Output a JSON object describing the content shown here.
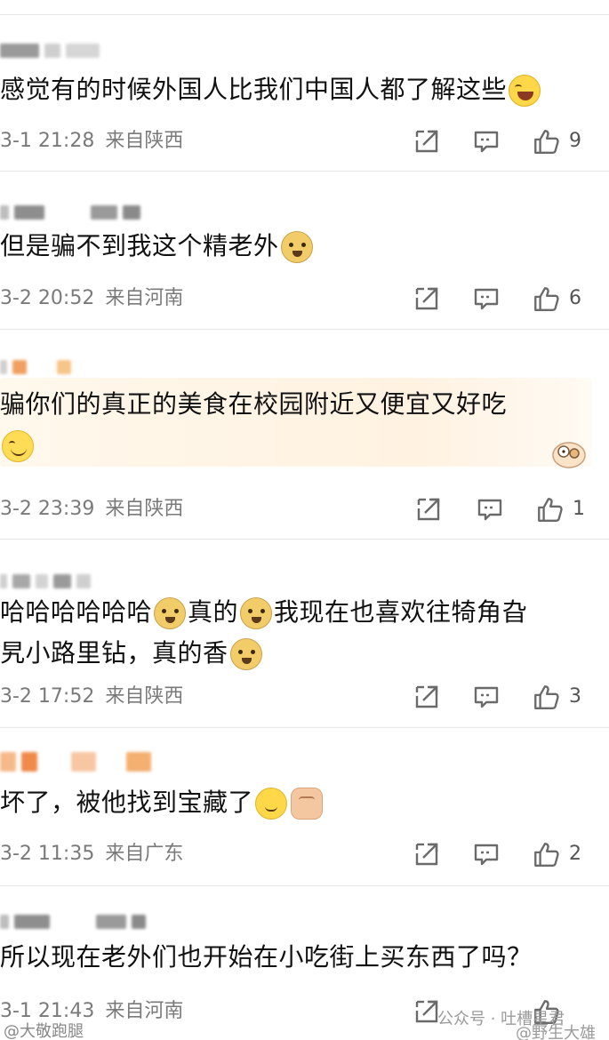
{
  "comments": [
    {
      "text": "感觉有的时候外国人比我们中国人都了解这些",
      "time": "3-1 21:28",
      "location": "来自陕西",
      "likes": "9",
      "emoji": "laugh"
    },
    {
      "text": "但是骗不到我这个精老外",
      "time": "3-2 20:52",
      "location": "来自河南",
      "likes": "6",
      "emoji": "doge"
    },
    {
      "text": "骗你们的真正的美食在校园附近又便宜又好吃",
      "time": "3-2 23:39",
      "location": "来自陕西",
      "likes": "1",
      "emoji": "smile"
    },
    {
      "text_part1": "哈哈哈哈哈哈",
      "text_part2": "真的",
      "text_part3": "我现在也喜欢往犄角旮",
      "text_line2": "旯小路里钻，真的香",
      "time": "3-2 17:52",
      "location": "来自陕西",
      "likes": "3"
    },
    {
      "text": "坏了，被他找到宝藏了",
      "time": "3-2 11:35",
      "location": "来自广东",
      "likes": "2"
    },
    {
      "text": "所以现在老外们也开始在小吃街上买东西了吗？",
      "time": "3-1 21:43",
      "location": "来自河南",
      "likes": ""
    }
  ],
  "icons": {
    "share": "share-icon",
    "comment": "comment-icon",
    "like": "thumbs-up-icon"
  },
  "watermarks": {
    "left": "@大敬跑腿",
    "right_account": "公众号 · 吐槽星君",
    "right_weibo": "@野生大雄"
  },
  "colors": {
    "meta_text": "#7a7a7a",
    "divider": "#e6e6e6",
    "icon_stroke": "#666666"
  }
}
